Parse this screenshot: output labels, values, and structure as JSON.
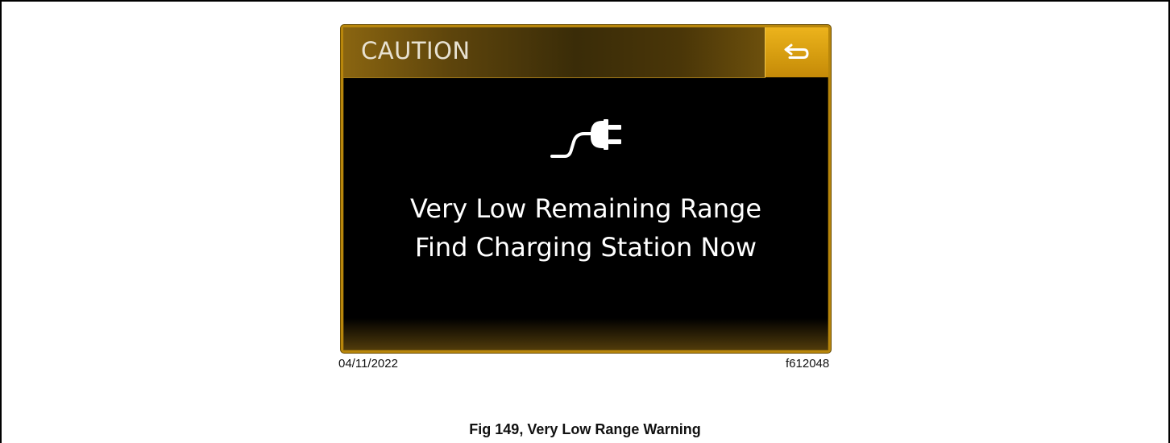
{
  "screen": {
    "header": {
      "title": "CAUTION"
    },
    "back_button": {
      "icon": "back-arrow-icon"
    },
    "status_icon": "plug-icon",
    "message": {
      "line1": "Very Low Remaining Range",
      "line2": "Find Charging Station Now"
    }
  },
  "figure": {
    "date": "04/11/2022",
    "figure_id": "f612048",
    "caption": "Fig 149, Very Low Range Warning"
  },
  "colors": {
    "accent": "#d49b0f",
    "screen_background": "#000000",
    "text": "#ffffff"
  }
}
